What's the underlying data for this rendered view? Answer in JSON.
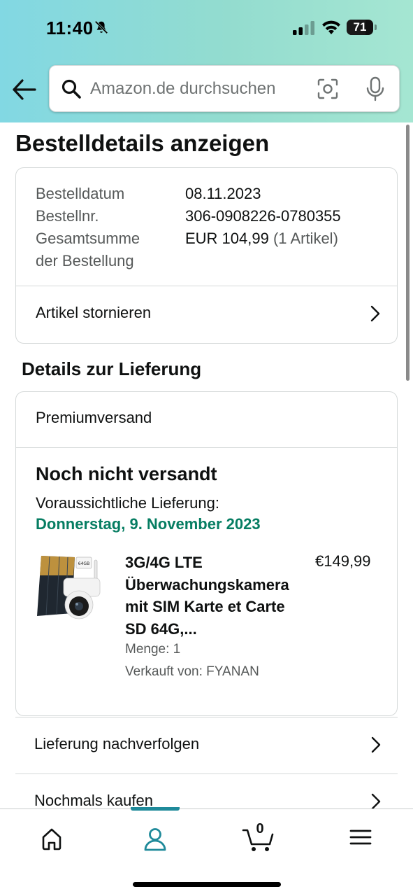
{
  "status_bar": {
    "time": "11:40",
    "battery_level": "71",
    "battery_fraction": 0.71
  },
  "search": {
    "placeholder": "Amazon.de durchsuchen"
  },
  "page": {
    "title": "Bestelldetails anzeigen"
  },
  "order": {
    "date_label": "Bestelldatum",
    "date_value": "08.11.2023",
    "number_label": "Bestellnr.",
    "number_value": "306-0908226-0780355",
    "total_label_line1": "Gesamtsumme",
    "total_label_line2": "der Bestellung",
    "total_value": "EUR 104,99",
    "total_items": "(1 Artikel)",
    "cancel_label": "Artikel stornieren"
  },
  "delivery": {
    "section_title": "Details zur Lieferung",
    "shipping_type": "Premiumversand",
    "status": "Noch nicht versandt",
    "eta_label": "Voraussichtliche Lieferung:",
    "eta_date": "Donnerstag, 9. November 2023",
    "product": {
      "title": "3G/4G LTE Überwachungskamera mit SIM Karte et Carte SD 64G,...",
      "price": "€149,99",
      "quantity": "Menge: 1",
      "seller": "Verkauft von: FYANAN",
      "image_label": "64GB"
    }
  },
  "actions": {
    "track": "Lieferung nachverfolgen",
    "buy_again": "Nochmals kaufen"
  },
  "nav": {
    "cart_count": "0",
    "active": "account"
  },
  "colors": {
    "accent": "#1f8a9a",
    "eta_green": "#067d62",
    "header_gradient_start": "#82d8e3",
    "header_gradient_end": "#a5e6d2"
  }
}
